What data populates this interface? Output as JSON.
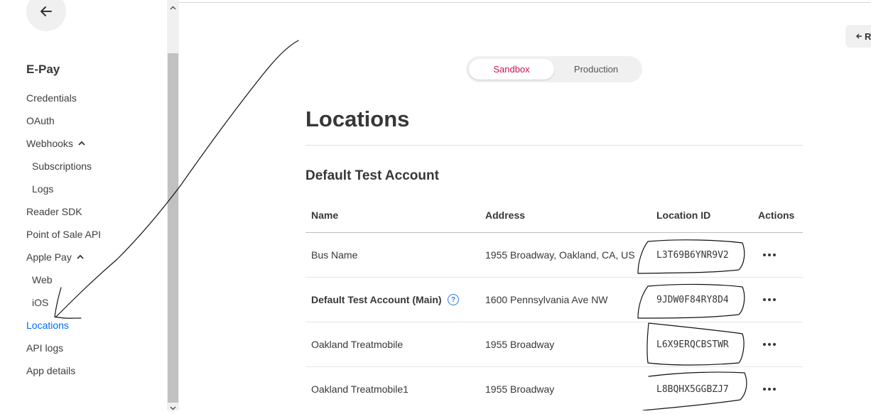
{
  "sidebar": {
    "app_title": "E-Pay",
    "items": [
      {
        "label": "Credentials"
      },
      {
        "label": "OAuth"
      },
      {
        "label": "Webhooks"
      },
      {
        "label": "Subscriptions"
      },
      {
        "label": "Logs"
      },
      {
        "label": "Reader SDK"
      },
      {
        "label": "Point of Sale API"
      },
      {
        "label": "Apple Pay"
      },
      {
        "label": "Web"
      },
      {
        "label": "iOS"
      },
      {
        "label": "Locations"
      },
      {
        "label": "API logs"
      },
      {
        "label": "App details"
      }
    ],
    "active_item": "Locations",
    "active_color": "#006aff"
  },
  "header": {
    "toggle": {
      "sandbox": "Sandbox",
      "production": "Production",
      "selected": "Sandbox",
      "selected_color": "#cc1454"
    },
    "right_button": "R"
  },
  "main": {
    "title": "Locations",
    "section": "Default Test Account",
    "columns": [
      "Name",
      "Address",
      "Location ID",
      "Actions"
    ],
    "rows": [
      {
        "name": "Bus Name",
        "address": "1955 Broadway, Oakland, CA, US",
        "location_id": "L3T69B6YNR9V2"
      },
      {
        "name": "Default Test Account (Main)",
        "address": "1600 Pennsylvania Ave NW",
        "location_id": "9JDW0F84RY8D4",
        "help": "?"
      },
      {
        "name": "Oakland Treatmobile",
        "address": "1955 Broadway",
        "location_id": "L6X9ERQCBSTWR"
      },
      {
        "name": "Oakland Treatmobile1",
        "address": "1955 Broadway",
        "location_id": "L8BQHX5GGBZJ7"
      }
    ]
  }
}
